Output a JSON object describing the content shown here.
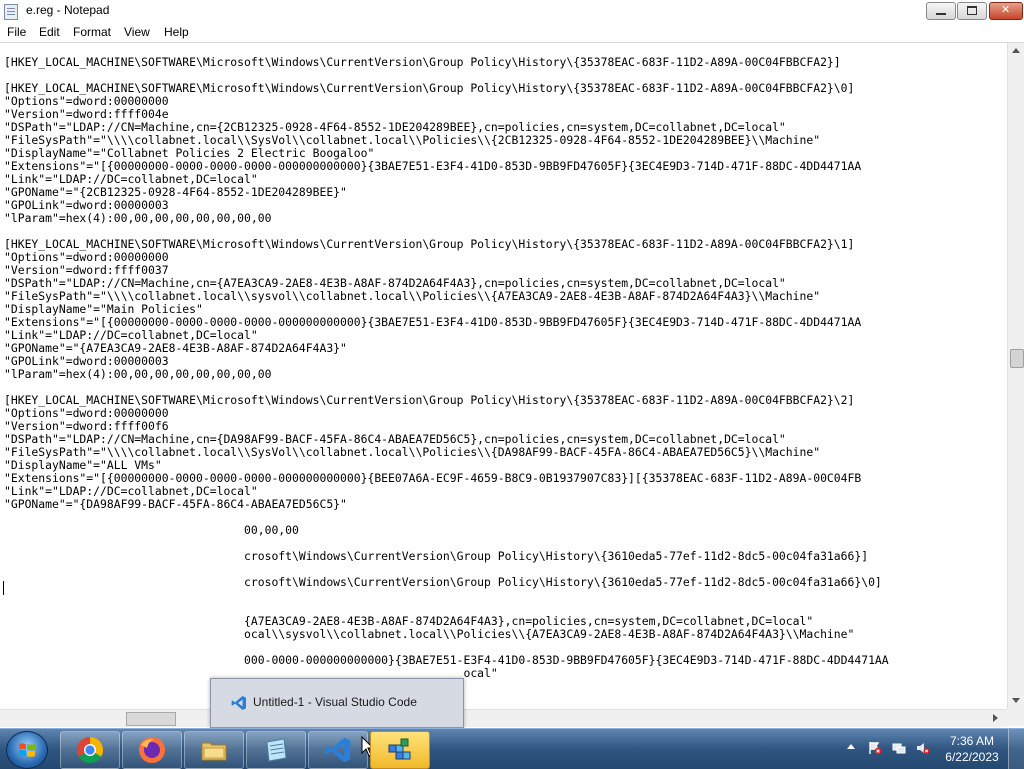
{
  "window": {
    "title": "e.reg - Notepad"
  },
  "menu": {
    "file": "File",
    "edit": "Edit",
    "format": "Format",
    "view": "View",
    "help": "Help"
  },
  "editor": {
    "lines": [
      "[HKEY_LOCAL_MACHINE\\SOFTWARE\\Microsoft\\Windows\\CurrentVersion\\Group Policy\\History\\{35378EAC-683F-11D2-A89A-00C04FBBCFA2}]",
      "",
      "[HKEY_LOCAL_MACHINE\\SOFTWARE\\Microsoft\\Windows\\CurrentVersion\\Group Policy\\History\\{35378EAC-683F-11D2-A89A-00C04FBBCFA2}\\0]",
      "\"Options\"=dword:00000000",
      "\"Version\"=dword:ffff004e",
      "\"DSPath\"=\"LDAP://CN=Machine,cn={2CB12325-0928-4F64-8552-1DE204289BEE},cn=policies,cn=system,DC=collabnet,DC=local\"",
      "\"FileSysPath\"=\"\\\\\\\\collabnet.local\\\\SysVol\\\\collabnet.local\\\\Policies\\\\{2CB12325-0928-4F64-8552-1DE204289BEE}\\\\Machine\"",
      "\"DisplayName\"=\"Collabnet Policies 2 Electric Boogaloo\"",
      "\"Extensions\"=\"[{00000000-0000-0000-0000-000000000000}{3BAE7E51-E3F4-41D0-853D-9BB9FD47605F}{3EC4E9D3-714D-471F-88DC-4DD4471AA",
      "\"Link\"=\"LDAP://DC=collabnet,DC=local\"",
      "\"GPOName\"=\"{2CB12325-0928-4F64-8552-1DE204289BEE}\"",
      "\"GPOLink\"=dword:00000003",
      "\"lParam\"=hex(4):00,00,00,00,00,00,00,00",
      "",
      "[HKEY_LOCAL_MACHINE\\SOFTWARE\\Microsoft\\Windows\\CurrentVersion\\Group Policy\\History\\{35378EAC-683F-11D2-A89A-00C04FBBCFA2}\\1]",
      "\"Options\"=dword:00000000",
      "\"Version\"=dword:ffff0037",
      "\"DSPath\"=\"LDAP://CN=Machine,cn={A7EA3CA9-2AE8-4E3B-A8AF-874D2A64F4A3},cn=policies,cn=system,DC=collabnet,DC=local\"",
      "\"FileSysPath\"=\"\\\\\\\\collabnet.local\\\\sysvol\\\\collabnet.local\\\\Policies\\\\{A7EA3CA9-2AE8-4E3B-A8AF-874D2A64F4A3}\\\\Machine\"",
      "\"DisplayName\"=\"Main Policies\"",
      "\"Extensions\"=\"[{00000000-0000-0000-0000-000000000000}{3BAE7E51-E3F4-41D0-853D-9BB9FD47605F}{3EC4E9D3-714D-471F-88DC-4DD4471AA",
      "\"Link\"=\"LDAP://DC=collabnet,DC=local\"",
      "\"GPOName\"=\"{A7EA3CA9-2AE8-4E3B-A8AF-874D2A64F4A3}\"",
      "\"GPOLink\"=dword:00000003",
      "\"lParam\"=hex(4):00,00,00,00,00,00,00,00",
      "",
      "[HKEY_LOCAL_MACHINE\\SOFTWARE\\Microsoft\\Windows\\CurrentVersion\\Group Policy\\History\\{35378EAC-683F-11D2-A89A-00C04FBBCFA2}\\2]",
      "\"Options\"=dword:00000000",
      "\"Version\"=dword:ffff00f6",
      "\"DSPath\"=\"LDAP://CN=Machine,cn={DA98AF99-BACF-45FA-86C4-ABAEA7ED56C5},cn=policies,cn=system,DC=collabnet,DC=local\"",
      "\"FileSysPath\"=\"\\\\\\\\collabnet.local\\\\SysVol\\\\collabnet.local\\\\Policies\\\\{DA98AF99-BACF-45FA-86C4-ABAEA7ED56C5}\\\\Machine\"",
      "\"DisplayName\"=\"ALL VMs\"",
      "\"Extensions\"=\"[{00000000-0000-0000-0000-000000000000}{BEE07A6A-EC9F-4659-B8C9-0B1937907C83}][{35378EAC-683F-11D2-A89A-00C04FB",
      "\"Link\"=\"LDAP://DC=collabnet,DC=local\"",
      "\"GPOName\"=\"{DA98AF99-BACF-45FA-86C4-ABAEA7ED56C5}\"",
      "",
      "                                   00,00,00",
      "",
      "                                   crosoft\\Windows\\CurrentVersion\\Group Policy\\History\\{3610eda5-77ef-11d2-8dc5-00c04fa31a66}]",
      "",
      "                                   crosoft\\Windows\\CurrentVersion\\Group Policy\\History\\{3610eda5-77ef-11d2-8dc5-00c04fa31a66}\\0]",
      "",
      "",
      "                                   {A7EA3CA9-2AE8-4E3B-A8AF-874D2A64F4A3},cn=policies,cn=system,DC=collabnet,DC=local\"",
      "                                   ocal\\\\sysvol\\\\collabnet.local\\\\Policies\\\\{A7EA3CA9-2AE8-4E3B-A8AF-874D2A64F4A3}\\\\Machine\"",
      "",
      "                                   000-0000-000000000000}{3BAE7E51-E3F4-41D0-853D-9BB9FD47605F}{3EC4E9D3-714D-471F-88DC-4DD4471AA",
      "                                                                   ocal\""
    ]
  },
  "taskbar": {
    "tooltip": "Untitled-1 - Visual Studio Code",
    "time": "7:36 AM",
    "date": "6/22/2023"
  }
}
